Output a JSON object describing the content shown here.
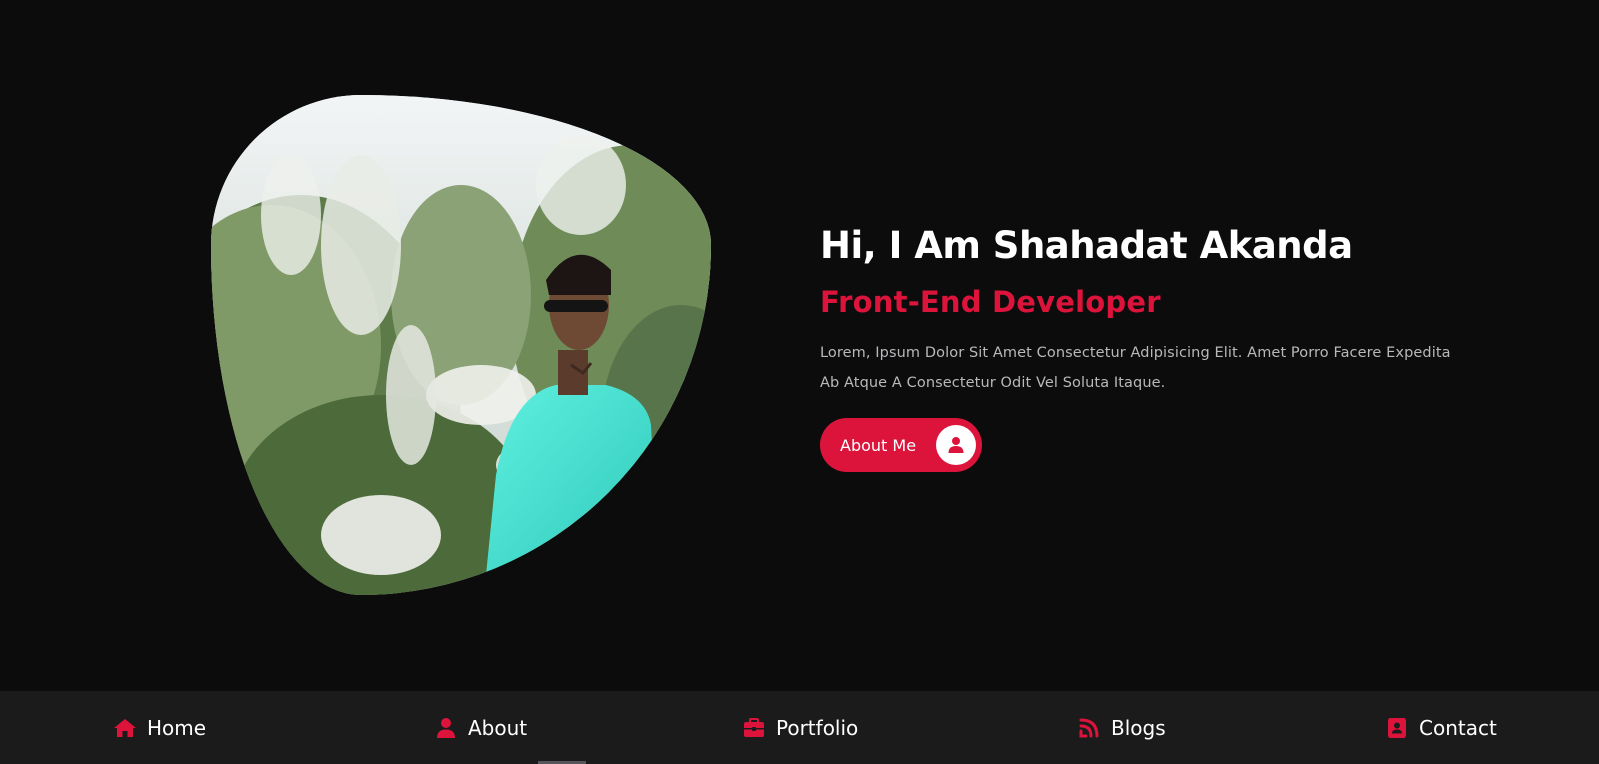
{
  "hero": {
    "title": "Hi, I Am Shahadat Akanda",
    "subtitle": "Front-End Developer",
    "description": "Lorem, Ipsum Dolor Sit Amet Consectetur Adipisicing Elit. Amet Porro Facere Expedita Ab Atque A Consectetur Odit Vel Soluta Itaque.",
    "button_label": "About Me",
    "button_icon": "user-icon",
    "photo": "profile-photo"
  },
  "nav": {
    "items": [
      {
        "label": "Home",
        "icon": "home-icon"
      },
      {
        "label": "About",
        "icon": "user-icon"
      },
      {
        "label": "Portfolio",
        "icon": "briefcase-icon"
      },
      {
        "label": "Blogs",
        "icon": "blog-icon"
      },
      {
        "label": "Contact",
        "icon": "contact-book-icon"
      }
    ]
  },
  "colors": {
    "background": "#0c0c0d",
    "accent": "#dc143c",
    "nav_background": "#1b1b1c",
    "text": "#ffffff",
    "muted_text": "#b9b9bc"
  }
}
